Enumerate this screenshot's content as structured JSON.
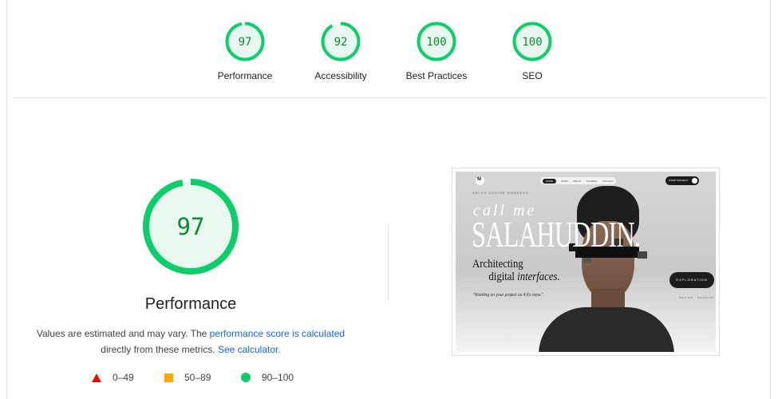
{
  "summary": {
    "gauges": [
      {
        "score": "97",
        "label": "Performance",
        "percent": 97
      },
      {
        "score": "92",
        "label": "Accessibility",
        "percent": 92
      },
      {
        "score": "100",
        "label": "Best Practices",
        "percent": 100
      },
      {
        "score": "100",
        "label": "SEO",
        "percent": 100
      }
    ]
  },
  "performance": {
    "score": "97",
    "percent": 97,
    "title": "Performance",
    "desc_part1": "Values are estimated and may vary. The ",
    "desc_link1": "performance score is calculated",
    "desc_part2": "directly from these metrics. ",
    "desc_link2": "See calculator."
  },
  "legend": [
    {
      "shape": "triangle",
      "range": "0–49",
      "color": "#eb0f00"
    },
    {
      "shape": "square",
      "range": "50–89",
      "color": "#ffa400"
    },
    {
      "shape": "circle",
      "range": "90–100",
      "color": "#0cce6b"
    }
  ],
  "colors": {
    "pass": "#0cce6b",
    "pass_text": "#0c8a36",
    "pass_bg": "#e8f8ee",
    "link": "#1a66d2"
  },
  "screenshot": {
    "nav_items": [
      "HOME",
      "WORK",
      "ABOUT",
      "JOURNAL",
      "CONTACT"
    ],
    "start_label": "START PROJECT",
    "tagline": "SALAH UDDINE WEBDESS",
    "call_me": "call me",
    "name": "SALAHUDDIN.",
    "line1": "Architecting",
    "line2a": "digital ",
    "line2b": "interfaces.",
    "quote": "\"Working on your project as if it's mine.\"",
    "explore": "EXPLORATION",
    "small": "DESIGN · DEVELOP"
  }
}
